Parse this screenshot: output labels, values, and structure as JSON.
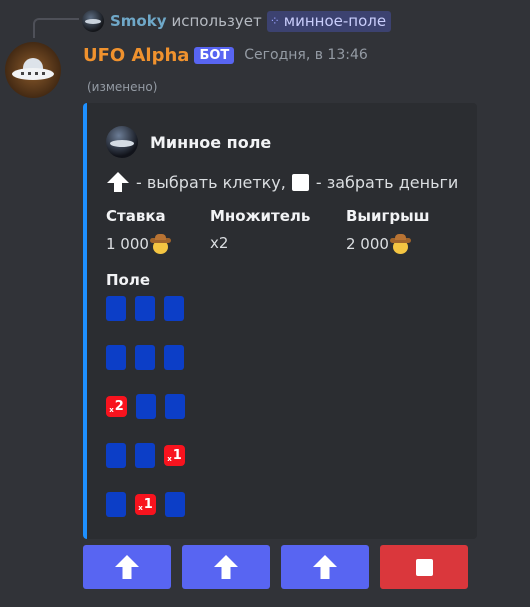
{
  "reply": {
    "user": "Smoky",
    "uses_text": "использует",
    "command_icon": "slash-command-icon",
    "command": "минное-поле"
  },
  "message": {
    "author": "UFO Alpha",
    "bot_tag": "БОТ",
    "timestamp": "Сегодня, в 13:46",
    "edited": "(изменено)",
    "author_name_color": "#f0922e"
  },
  "embed": {
    "accent_color": "#1e90ff",
    "author": "Минное поле",
    "description": {
      "pick_text": "- выбрать клетку,",
      "take_text": "- забрать деньги"
    },
    "fields": {
      "bet": {
        "name": "Ставка",
        "value": "1 000",
        "icon": "cowboy-emoji"
      },
      "multiplier": {
        "name": "Множитель",
        "value": "x2"
      },
      "win": {
        "name": "Выигрыш",
        "value": "2 000",
        "icon": "cowboy-emoji"
      }
    },
    "board": {
      "name": "Поле",
      "rows": [
        [
          "blue",
          "blue",
          "blue"
        ],
        [
          "blue",
          "blue",
          "blue"
        ],
        [
          "x2",
          "blue",
          "blue"
        ],
        [
          "blue",
          "blue",
          "x1"
        ],
        [
          "blue",
          "x1",
          "blue"
        ]
      ],
      "cell_colors": {
        "blue": "#0c3ec7",
        "red": "#f8131e"
      }
    }
  },
  "buttons": [
    {
      "icon": "arrow-up-icon",
      "style": "blurple"
    },
    {
      "icon": "arrow-up-icon",
      "style": "blurple"
    },
    {
      "icon": "arrow-up-icon",
      "style": "blurple"
    },
    {
      "icon": "stop-square-icon",
      "style": "danger"
    }
  ]
}
